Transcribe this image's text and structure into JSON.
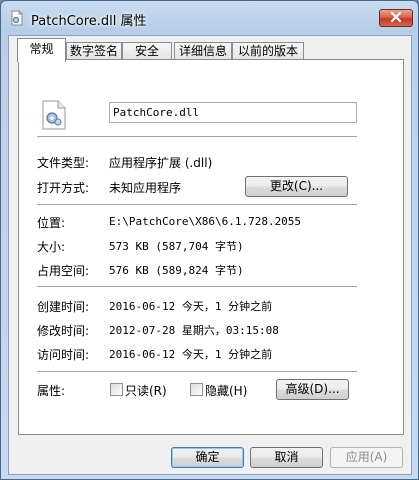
{
  "window": {
    "title": "PatchCore.dll 属性"
  },
  "tabs": [
    {
      "label": "常规",
      "active": true
    },
    {
      "label": "数字签名",
      "active": false
    },
    {
      "label": "安全",
      "active": false
    },
    {
      "label": "详细信息",
      "active": false
    },
    {
      "label": "以前的版本",
      "active": false
    }
  ],
  "general": {
    "file_name": "PatchCore.dll",
    "file_type_label": "文件类型:",
    "file_type_value": "应用程序扩展 (.dll)",
    "open_with_label": "打开方式:",
    "open_with_value": "未知应用程序",
    "change_button": "更改(C)...",
    "location_label": "位置:",
    "location_value": "E:\\PatchCore\\X86\\6.1.728.2055",
    "size_label": "大小:",
    "size_value": "573 KB (587,704 字节)",
    "size_on_disk_label": "占用空间:",
    "size_on_disk_value": "576 KB (589,824 字节)",
    "created_label": "创建时间:",
    "created_value": "2016-06-12 今天，1 分钟之前",
    "modified_label": "修改时间:",
    "modified_value": "2012-07-28 星期六，03:15:08",
    "accessed_label": "访问时间:",
    "accessed_value": "2016-06-12 今天，1 分钟之前",
    "attributes_label": "属性:",
    "readonly_label": "只读(R)",
    "hidden_label": "隐藏(H)",
    "advanced_button": "高级(D)..."
  },
  "footer": {
    "ok": "确定",
    "cancel": "取消",
    "apply": "应用(A)"
  },
  "icons": {
    "title": "dll-file-icon",
    "close": "close-icon",
    "file": "dll-file-icon"
  }
}
